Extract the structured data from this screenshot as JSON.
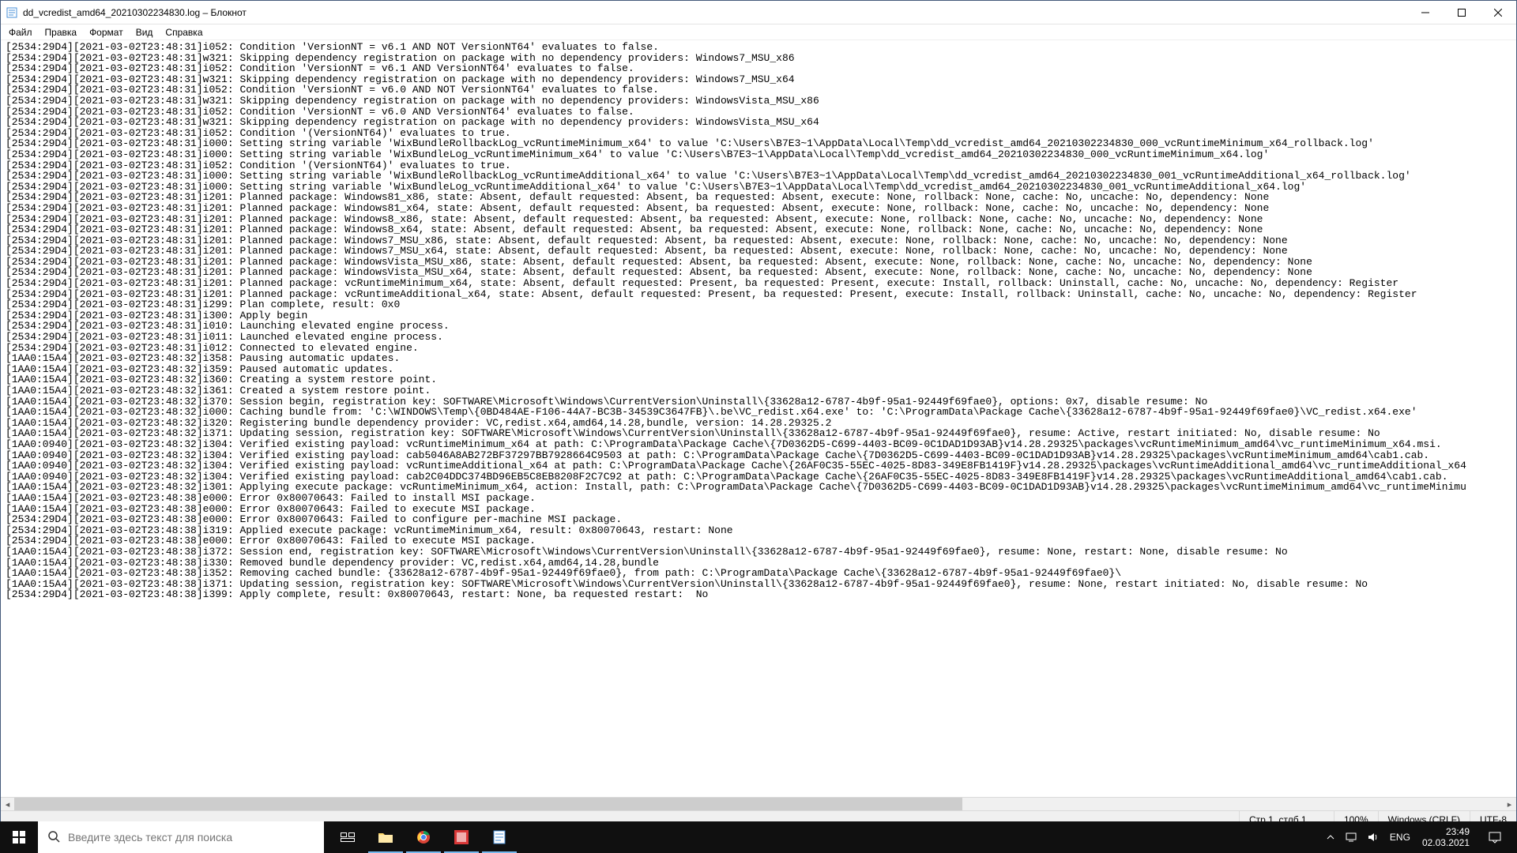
{
  "window": {
    "title": "dd_vcredist_amd64_20210302234830.log – Блокнот"
  },
  "menu": {
    "file": "Файл",
    "edit": "Правка",
    "format": "Формат",
    "view": "Вид",
    "help": "Справка"
  },
  "log_lines": [
    "[2534:29D4][2021-03-02T23:48:31]i052: Condition 'VersionNT = v6.1 AND NOT VersionNT64' evaluates to false.",
    "[2534:29D4][2021-03-02T23:48:31]w321: Skipping dependency registration on package with no dependency providers: Windows7_MSU_x86",
    "[2534:29D4][2021-03-02T23:48:31]i052: Condition 'VersionNT = v6.1 AND VersionNT64' evaluates to false.",
    "[2534:29D4][2021-03-02T23:48:31]w321: Skipping dependency registration on package with no dependency providers: Windows7_MSU_x64",
    "[2534:29D4][2021-03-02T23:48:31]i052: Condition 'VersionNT = v6.0 AND NOT VersionNT64' evaluates to false.",
    "[2534:29D4][2021-03-02T23:48:31]w321: Skipping dependency registration on package with no dependency providers: WindowsVista_MSU_x86",
    "[2534:29D4][2021-03-02T23:48:31]i052: Condition 'VersionNT = v6.0 AND VersionNT64' evaluates to false.",
    "[2534:29D4][2021-03-02T23:48:31]w321: Skipping dependency registration on package with no dependency providers: WindowsVista_MSU_x64",
    "[2534:29D4][2021-03-02T23:48:31]i052: Condition '(VersionNT64)' evaluates to true.",
    "[2534:29D4][2021-03-02T23:48:31]i000: Setting string variable 'WixBundleRollbackLog_vcRuntimeMinimum_x64' to value 'C:\\Users\\B7E3~1\\AppData\\Local\\Temp\\dd_vcredist_amd64_20210302234830_000_vcRuntimeMinimum_x64_rollback.log'",
    "[2534:29D4][2021-03-02T23:48:31]i000: Setting string variable 'WixBundleLog_vcRuntimeMinimum_x64' to value 'C:\\Users\\B7E3~1\\AppData\\Local\\Temp\\dd_vcredist_amd64_20210302234830_000_vcRuntimeMinimum_x64.log'",
    "[2534:29D4][2021-03-02T23:48:31]i052: Condition '(VersionNT64)' evaluates to true.",
    "[2534:29D4][2021-03-02T23:48:31]i000: Setting string variable 'WixBundleRollbackLog_vcRuntimeAdditional_x64' to value 'C:\\Users\\B7E3~1\\AppData\\Local\\Temp\\dd_vcredist_amd64_20210302234830_001_vcRuntimeAdditional_x64_rollback.log'",
    "[2534:29D4][2021-03-02T23:48:31]i000: Setting string variable 'WixBundleLog_vcRuntimeAdditional_x64' to value 'C:\\Users\\B7E3~1\\AppData\\Local\\Temp\\dd_vcredist_amd64_20210302234830_001_vcRuntimeAdditional_x64.log'",
    "[2534:29D4][2021-03-02T23:48:31]i201: Planned package: Windows81_x86, state: Absent, default requested: Absent, ba requested: Absent, execute: None, rollback: None, cache: No, uncache: No, dependency: None",
    "[2534:29D4][2021-03-02T23:48:31]i201: Planned package: Windows81_x64, state: Absent, default requested: Absent, ba requested: Absent, execute: None, rollback: None, cache: No, uncache: No, dependency: None",
    "[2534:29D4][2021-03-02T23:48:31]i201: Planned package: Windows8_x86, state: Absent, default requested: Absent, ba requested: Absent, execute: None, rollback: None, cache: No, uncache: No, dependency: None",
    "[2534:29D4][2021-03-02T23:48:31]i201: Planned package: Windows8_x64, state: Absent, default requested: Absent, ba requested: Absent, execute: None, rollback: None, cache: No, uncache: No, dependency: None",
    "[2534:29D4][2021-03-02T23:48:31]i201: Planned package: Windows7_MSU_x86, state: Absent, default requested: Absent, ba requested: Absent, execute: None, rollback: None, cache: No, uncache: No, dependency: None",
    "[2534:29D4][2021-03-02T23:48:31]i201: Planned package: Windows7_MSU_x64, state: Absent, default requested: Absent, ba requested: Absent, execute: None, rollback: None, cache: No, uncache: No, dependency: None",
    "[2534:29D4][2021-03-02T23:48:31]i201: Planned package: WindowsVista_MSU_x86, state: Absent, default requested: Absent, ba requested: Absent, execute: None, rollback: None, cache: No, uncache: No, dependency: None",
    "[2534:29D4][2021-03-02T23:48:31]i201: Planned package: WindowsVista_MSU_x64, state: Absent, default requested: Absent, ba requested: Absent, execute: None, rollback: None, cache: No, uncache: No, dependency: None",
    "[2534:29D4][2021-03-02T23:48:31]i201: Planned package: vcRuntimeMinimum_x64, state: Absent, default requested: Present, ba requested: Present, execute: Install, rollback: Uninstall, cache: No, uncache: No, dependency: Register",
    "[2534:29D4][2021-03-02T23:48:31]i201: Planned package: vcRuntimeAdditional_x64, state: Absent, default requested: Present, ba requested: Present, execute: Install, rollback: Uninstall, cache: No, uncache: No, dependency: Register",
    "[2534:29D4][2021-03-02T23:48:31]i299: Plan complete, result: 0x0",
    "[2534:29D4][2021-03-02T23:48:31]i300: Apply begin",
    "[2534:29D4][2021-03-02T23:48:31]i010: Launching elevated engine process.",
    "[2534:29D4][2021-03-02T23:48:31]i011: Launched elevated engine process.",
    "[2534:29D4][2021-03-02T23:48:31]i012: Connected to elevated engine.",
    "[1AA0:15A4][2021-03-02T23:48:32]i358: Pausing automatic updates.",
    "[1AA0:15A4][2021-03-02T23:48:32]i359: Paused automatic updates.",
    "[1AA0:15A4][2021-03-02T23:48:32]i360: Creating a system restore point.",
    "[1AA0:15A4][2021-03-02T23:48:32]i361: Created a system restore point.",
    "[1AA0:15A4][2021-03-02T23:48:32]i370: Session begin, registration key: SOFTWARE\\Microsoft\\Windows\\CurrentVersion\\Uninstall\\{33628a12-6787-4b9f-95a1-92449f69fae0}, options: 0x7, disable resume: No",
    "[1AA0:15A4][2021-03-02T23:48:32]i000: Caching bundle from: 'C:\\WINDOWS\\Temp\\{0BD484AE-F106-44A7-BC3B-34539C3647FB}\\.be\\VC_redist.x64.exe' to: 'C:\\ProgramData\\Package Cache\\{33628a12-6787-4b9f-95a1-92449f69fae0}\\VC_redist.x64.exe'",
    "[1AA0:15A4][2021-03-02T23:48:32]i320: Registering bundle dependency provider: VC,redist.x64,amd64,14.28,bundle, version: 14.28.29325.2",
    "[1AA0:15A4][2021-03-02T23:48:32]i371: Updating session, registration key: SOFTWARE\\Microsoft\\Windows\\CurrentVersion\\Uninstall\\{33628a12-6787-4b9f-95a1-92449f69fae0}, resume: Active, restart initiated: No, disable resume: No",
    "[1AA0:0940][2021-03-02T23:48:32]i304: Verified existing payload: vcRuntimeMinimum_x64 at path: C:\\ProgramData\\Package Cache\\{7D0362D5-C699-4403-BC09-0C1DAD1D93AB}v14.28.29325\\packages\\vcRuntimeMinimum_amd64\\vc_runtimeMinimum_x64.msi.",
    "[1AA0:0940][2021-03-02T23:48:32]i304: Verified existing payload: cab5046A8AB272BF37297BB7928664C9503 at path: C:\\ProgramData\\Package Cache\\{7D0362D5-C699-4403-BC09-0C1DAD1D93AB}v14.28.29325\\packages\\vcRuntimeMinimum_amd64\\cab1.cab.",
    "[1AA0:0940][2021-03-02T23:48:32]i304: Verified existing payload: vcRuntimeAdditional_x64 at path: C:\\ProgramData\\Package Cache\\{26AF0C35-55EC-4025-8D83-349E8FB1419F}v14.28.29325\\packages\\vcRuntimeAdditional_amd64\\vc_runtimeAdditional_x64",
    "[1AA0:0940][2021-03-02T23:48:32]i304: Verified existing payload: cab2C04DDC374BD96EB5C8EB8208F2C7C92 at path: C:\\ProgramData\\Package Cache\\{26AF0C35-55EC-4025-8D83-349E8FB1419F}v14.28.29325\\packages\\vcRuntimeAdditional_amd64\\cab1.cab.",
    "[1AA0:15A4][2021-03-02T23:48:32]i301: Applying execute package: vcRuntimeMinimum_x64, action: Install, path: C:\\ProgramData\\Package Cache\\{7D0362D5-C699-4403-BC09-0C1DAD1D93AB}v14.28.29325\\packages\\vcRuntimeMinimum_amd64\\vc_runtimeMinimu",
    "[1AA0:15A4][2021-03-02T23:48:38]e000: Error 0x80070643: Failed to install MSI package.",
    "[1AA0:15A4][2021-03-02T23:48:38]e000: Error 0x80070643: Failed to execute MSI package.",
    "[2534:29D4][2021-03-02T23:48:38]e000: Error 0x80070643: Failed to configure per-machine MSI package.",
    "[2534:29D4][2021-03-02T23:48:38]i319: Applied execute package: vcRuntimeMinimum_x64, result: 0x80070643, restart: None",
    "[2534:29D4][2021-03-02T23:48:38]e000: Error 0x80070643: Failed to execute MSI package.",
    "[1AA0:15A4][2021-03-02T23:48:38]i372: Session end, registration key: SOFTWARE\\Microsoft\\Windows\\CurrentVersion\\Uninstall\\{33628a12-6787-4b9f-95a1-92449f69fae0}, resume: None, restart: None, disable resume: No",
    "[1AA0:15A4][2021-03-02T23:48:38]i330: Removed bundle dependency provider: VC,redist.x64,amd64,14.28,bundle",
    "[1AA0:15A4][2021-03-02T23:48:38]i352: Removing cached bundle: {33628a12-6787-4b9f-95a1-92449f69fae0}, from path: C:\\ProgramData\\Package Cache\\{33628a12-6787-4b9f-95a1-92449f69fae0}\\",
    "[1AA0:15A4][2021-03-02T23:48:38]i371: Updating session, registration key: SOFTWARE\\Microsoft\\Windows\\CurrentVersion\\Uninstall\\{33628a12-6787-4b9f-95a1-92449f69fae0}, resume: None, restart initiated: No, disable resume: No",
    "[2534:29D4][2021-03-02T23:48:38]i399: Apply complete, result: 0x80070643, restart: None, ba requested restart:  No"
  ],
  "statusbar": {
    "pos": "Стр 1, стлб 1",
    "zoom": "100%",
    "eol": "Windows (CRLF)",
    "enc": "UTF-8"
  },
  "taskbar": {
    "search_placeholder": "Введите здесь текст для поиска",
    "lang": "ENG",
    "time": "23:49",
    "date": "02.03.2021"
  }
}
